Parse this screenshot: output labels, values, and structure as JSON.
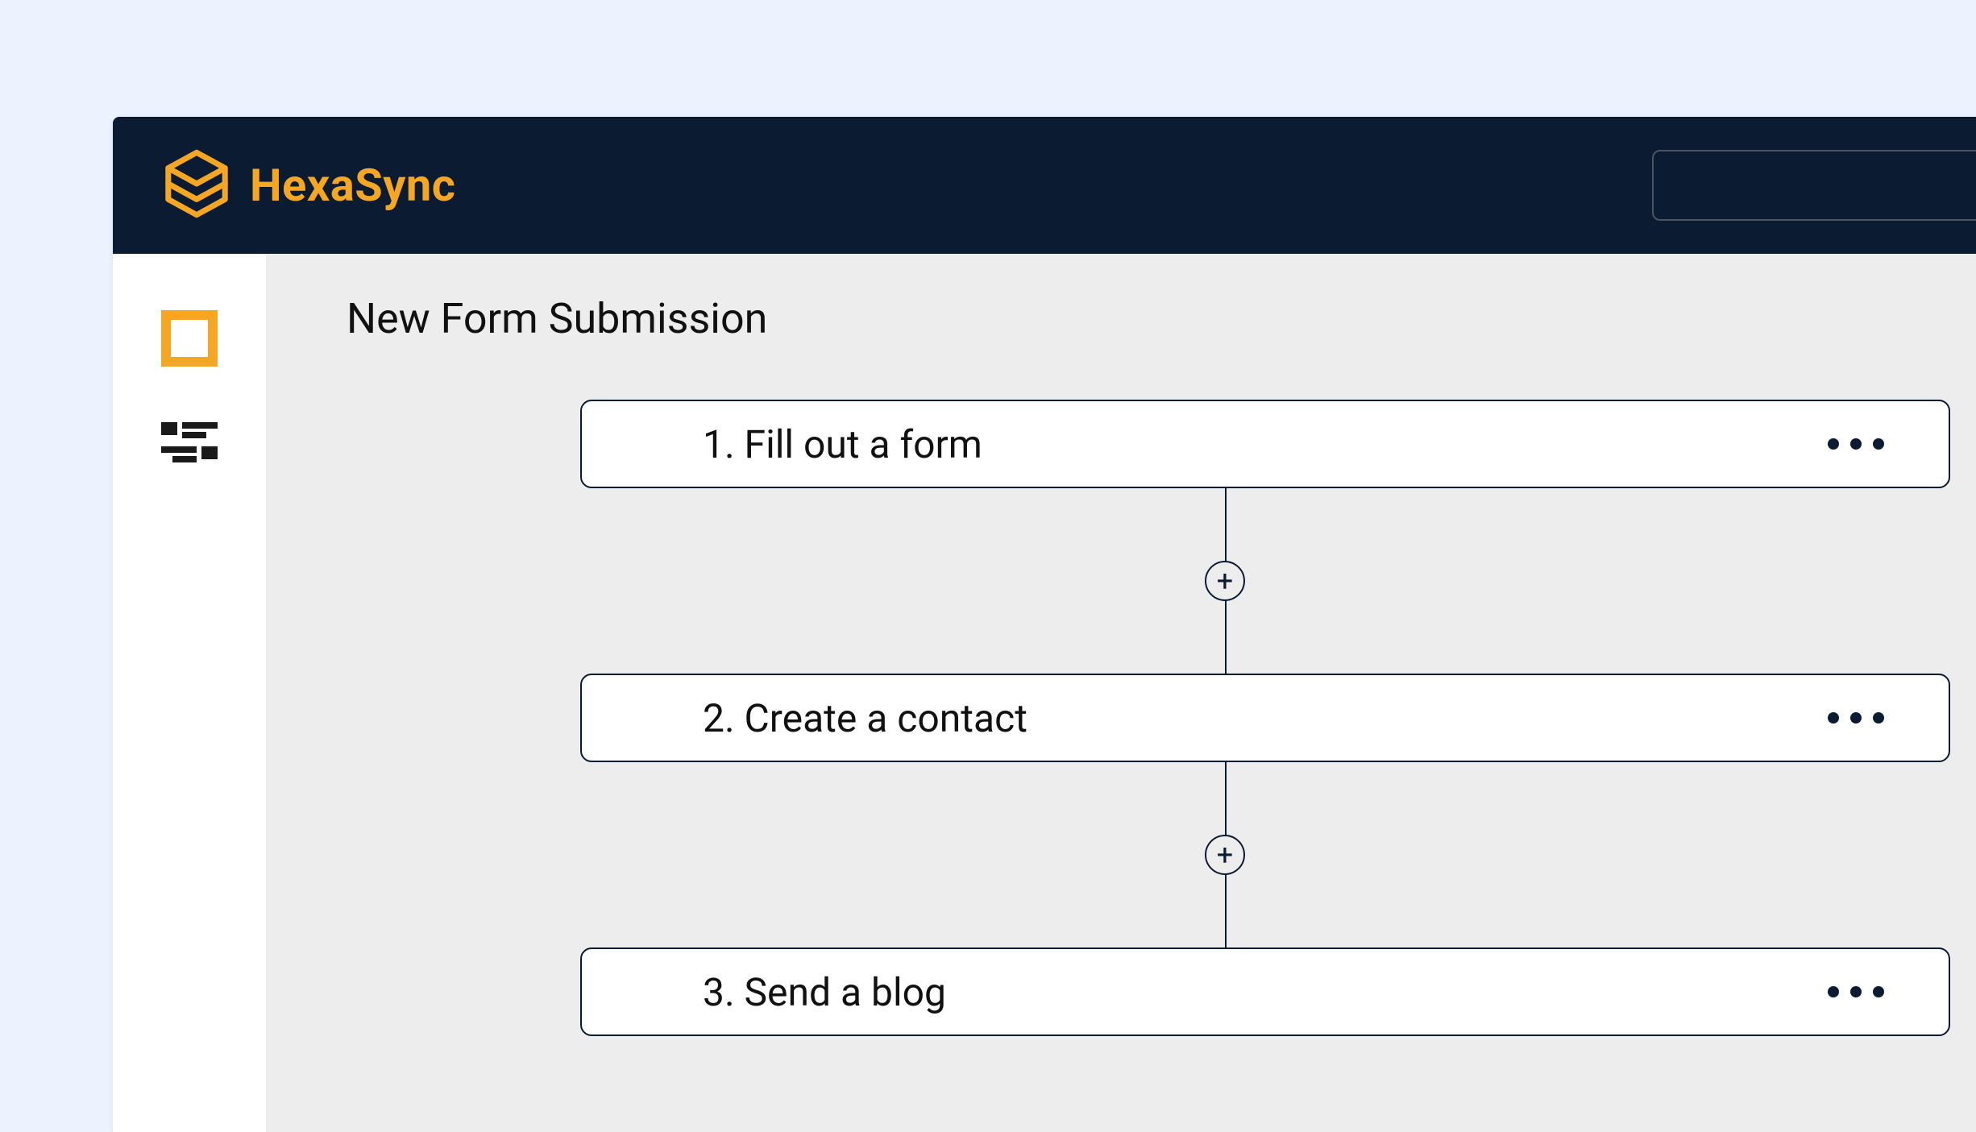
{
  "brand": {
    "name": "HexaSync",
    "accent_color": "#f5a623",
    "header_bg": "#0b1b32"
  },
  "sidebar": {
    "items": [
      {
        "icon_name": "square-icon",
        "active": true
      },
      {
        "icon_name": "checker-icon",
        "active": false
      }
    ]
  },
  "page": {
    "title": "New Form Submission"
  },
  "flow": {
    "steps": [
      {
        "number": "1.",
        "label": "Fill out a form"
      },
      {
        "number": "2.",
        "label": "Create a contact"
      },
      {
        "number": "3.",
        "label": "Send a blog"
      }
    ]
  }
}
